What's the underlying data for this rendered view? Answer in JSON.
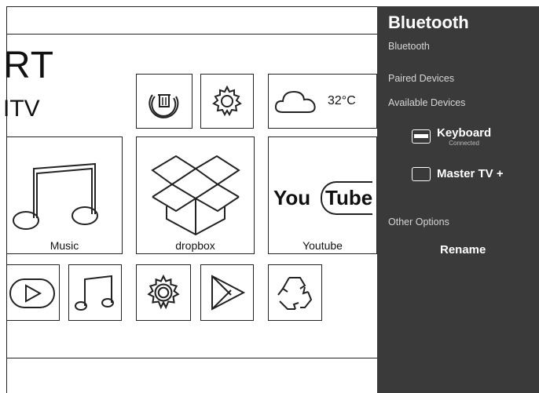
{
  "home": {
    "logo_line1": "RT",
    "logo_line2": "ITV",
    "weather_temp": "32°C",
    "youtube_logo_you": "You",
    "youtube_logo_tube": "Tube",
    "tiles": {
      "music": "Music",
      "dropbox": "dropbox",
      "youtube": "Youtube"
    }
  },
  "bluetooth_panel": {
    "title": "Bluetooth",
    "bluetooth_toggle_label": "Bluetooth",
    "paired_devices_label": "Paired Devices",
    "available_devices_label": "Available Devices",
    "devices": [
      {
        "name": "Keyboard",
        "status": "Connected",
        "icon": "keyboard-icon"
      },
      {
        "name": "Master TV +",
        "status": "",
        "icon": "tv-icon"
      }
    ],
    "other_options_label": "Other Options",
    "rename_label": "Rename"
  },
  "colors": {
    "panel_bg": "#3a3a3a",
    "panel_text": "#ffffff",
    "sketch_stroke": "#222222"
  }
}
